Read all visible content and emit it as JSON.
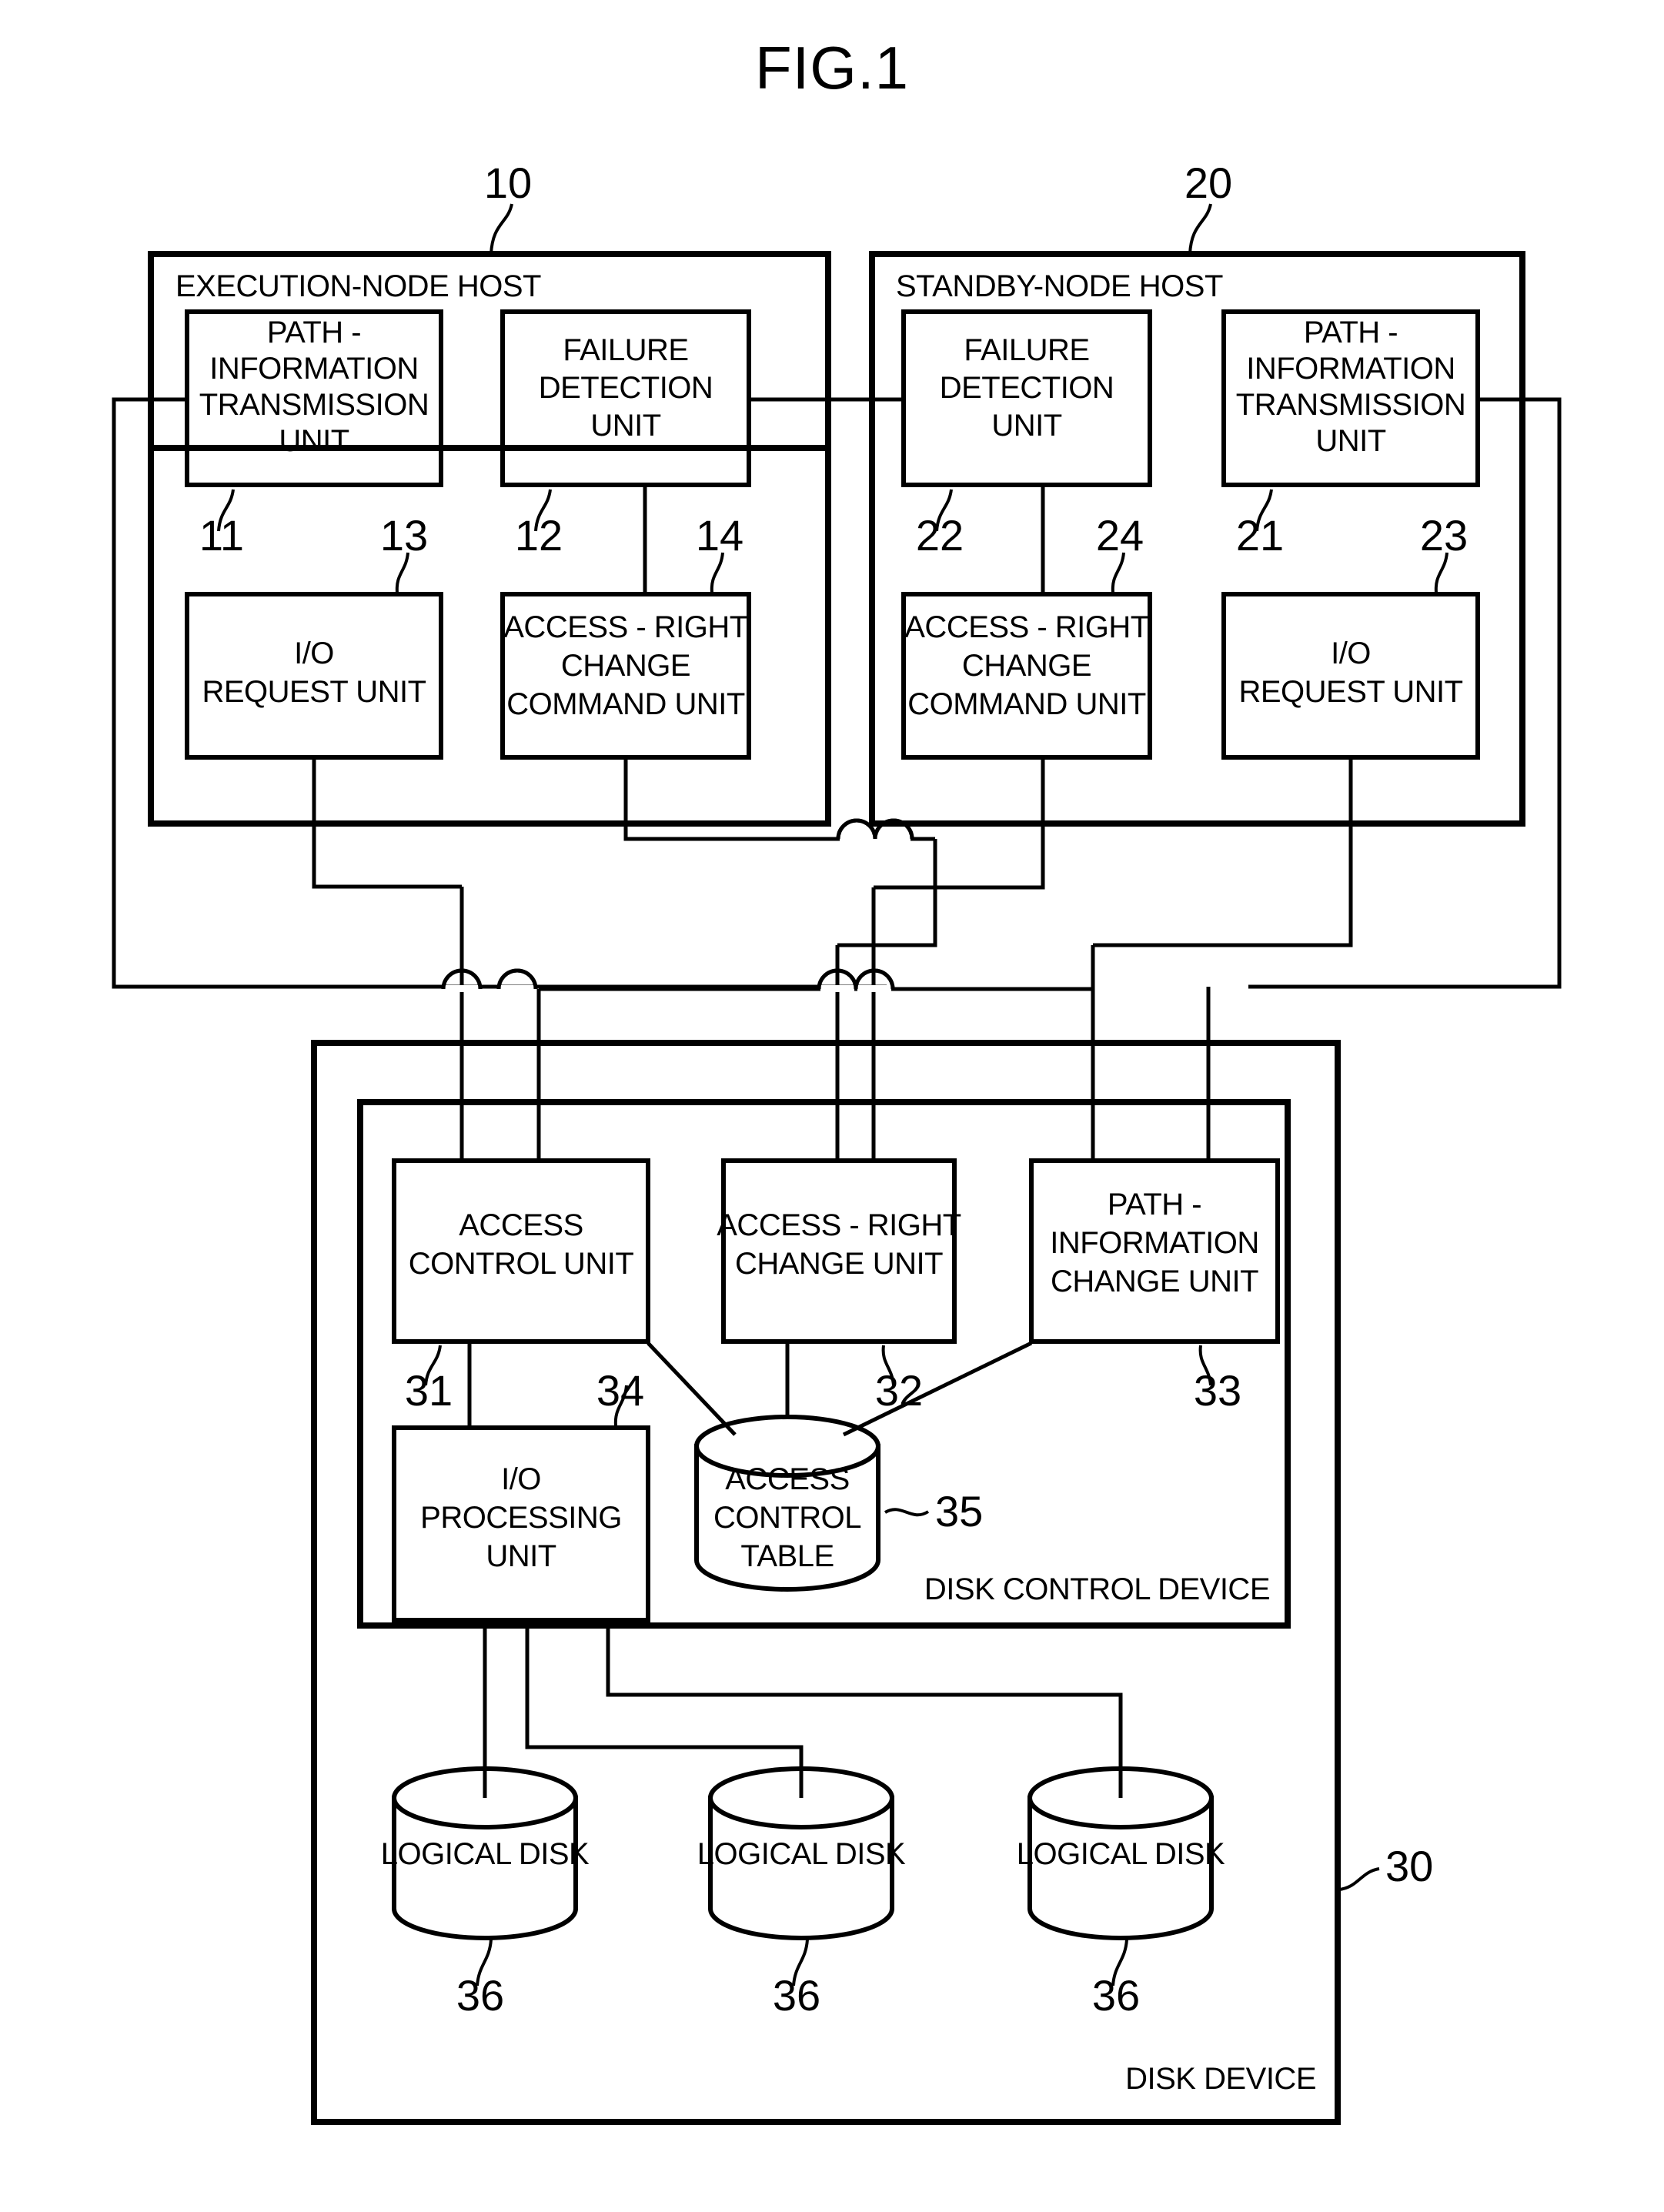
{
  "figure": {
    "title": "FIG.1"
  },
  "hosts": [
    {
      "id": "execution-node-host",
      "container_label": "EXECUTION-NODE HOST",
      "container_ref": "10",
      "units": [
        {
          "id": "path-information-transmission-unit",
          "lines": [
            "PATH -",
            "INFORMATION",
            "TRANSMISSION",
            "UNIT"
          ],
          "ref": "11"
        },
        {
          "id": "failure-detection-unit",
          "lines": [
            "FAILURE",
            "DETECTION",
            "UNIT"
          ],
          "ref": "12"
        },
        {
          "id": "io-request-unit",
          "lines": [
            "I/O",
            "REQUEST UNIT"
          ],
          "ref": "13"
        },
        {
          "id": "access-right-change-command-unit",
          "lines": [
            "ACCESS - RIGHT",
            "CHANGE",
            "COMMAND UNIT"
          ],
          "ref": "14"
        }
      ]
    },
    {
      "id": "standby-node-host",
      "container_label": "STANDBY-NODE HOST",
      "container_ref": "20",
      "units": [
        {
          "id": "failure-detection-unit",
          "lines": [
            "FAILURE",
            "DETECTION",
            "UNIT"
          ],
          "ref": "22"
        },
        {
          "id": "path-information-transmission-unit",
          "lines": [
            "PATH -",
            "INFORMATION",
            "TRANSMISSION",
            "UNIT"
          ],
          "ref": "21"
        },
        {
          "id": "access-right-change-command-unit",
          "lines": [
            "ACCESS - RIGHT",
            "CHANGE",
            "COMMAND UNIT"
          ],
          "ref": "24"
        },
        {
          "id": "io-request-unit",
          "lines": [
            "I/O",
            "REQUEST UNIT"
          ],
          "ref": "23"
        }
      ]
    }
  ],
  "disk_device": {
    "container_label": "DISK DEVICE",
    "container_ref": "30",
    "control_device": {
      "container_label": "DISK CONTROL DEVICE",
      "units": [
        {
          "id": "access-control-unit",
          "lines": [
            "ACCESS",
            "CONTROL UNIT"
          ],
          "ref": "31"
        },
        {
          "id": "access-right-change-unit",
          "lines": [
            "ACCESS - RIGHT",
            "CHANGE UNIT"
          ],
          "ref": "32"
        },
        {
          "id": "path-information-change-unit",
          "lines": [
            "PATH -",
            "INFORMATION",
            "CHANGE UNIT"
          ],
          "ref": "33"
        },
        {
          "id": "io-processing-unit",
          "lines": [
            "I/O",
            "PROCESSING",
            "UNIT"
          ],
          "ref": "34"
        }
      ],
      "table": {
        "id": "access-control-table",
        "lines": [
          "ACCESS",
          "CONTROL",
          "TABLE"
        ],
        "ref": "35"
      }
    },
    "logical_disks": [
      {
        "id": "logical-disk-1",
        "label": "LOGICAL DISK",
        "ref": "36"
      },
      {
        "id": "logical-disk-2",
        "label": "LOGICAL DISK",
        "ref": "36"
      },
      {
        "id": "logical-disk-3",
        "label": "LOGICAL DISK",
        "ref": "36"
      }
    ]
  },
  "colors": {
    "ink": "#000000",
    "paper": "#ffffff"
  }
}
